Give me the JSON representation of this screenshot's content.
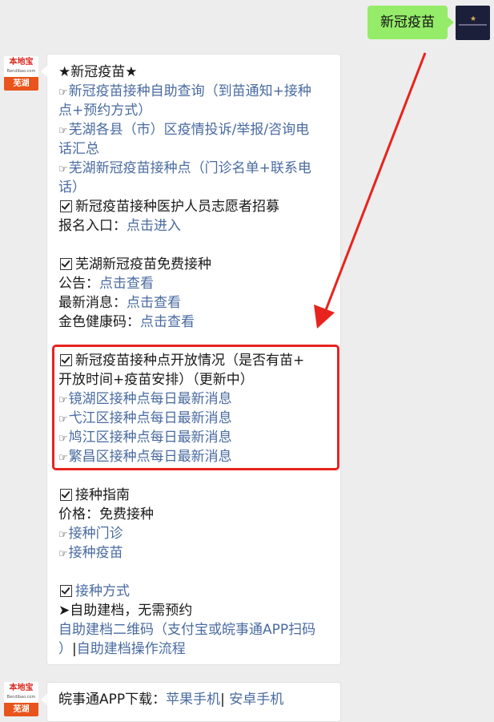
{
  "outgoing": {
    "text": "新冠疫苗"
  },
  "bot": {
    "brand": "本地宝",
    "url": "Bendibao.com",
    "city": "芜湖"
  },
  "message": {
    "title": "★新冠疫苗★",
    "links_top": [
      "新冠疫苗接种自助查询（到苗通知+接种",
      "点+预约方式）",
      "芜湖各县（市）区疫情投诉/举报/咨询电",
      "话汇总",
      "芜湖新冠疫苗接种点（门诊名单+联系电",
      "话）"
    ],
    "volunteer": {
      "heading": "新冠疫苗接种医护人员志愿者招募",
      "label": "报名入口：",
      "link": "点击进入"
    },
    "free": {
      "heading": "芜湖新冠疫苗免费接种",
      "rows": [
        {
          "label": "公告：",
          "link": "点击查看"
        },
        {
          "label": "最新消息：",
          "link": "点击查看"
        },
        {
          "label": "金色健康码：",
          "link": "点击查看"
        }
      ]
    },
    "sites": {
      "heading_line1": "新冠疫苗接种点开放情况（是否有苗+",
      "heading_line2": "开放时间+疫苗安排）（更新中）",
      "links": [
        "镜湖区接种点每日最新消息",
        "弋江区接种点每日最新消息",
        "鸠江区接种点每日最新消息",
        "繁昌区接种点每日最新消息"
      ]
    },
    "guide": {
      "heading": "接种指南",
      "price": "价格：免费接种",
      "links": [
        "接种门诊",
        "接种疫苗"
      ]
    },
    "method": {
      "heading": "接种方式",
      "bullet": "➤自助建档，无需预约",
      "link_line1": "自助建档二维码（支付宝或皖事通APP扫码",
      "link_line2_a": "）",
      "link_line2_sep": "|",
      "link_line2_b": "自助建档操作流程"
    }
  },
  "message2": {
    "label": "皖事通APP下载：",
    "link_a": "苹果手机",
    "sep": "| ",
    "link_b": "安卓手机"
  },
  "colors": {
    "link": "#4a6ba0",
    "highlight": "#e8231e",
    "bubble_out": "#95ec69"
  },
  "icons": {
    "hand": "☞",
    "check": "check-box-icon"
  }
}
